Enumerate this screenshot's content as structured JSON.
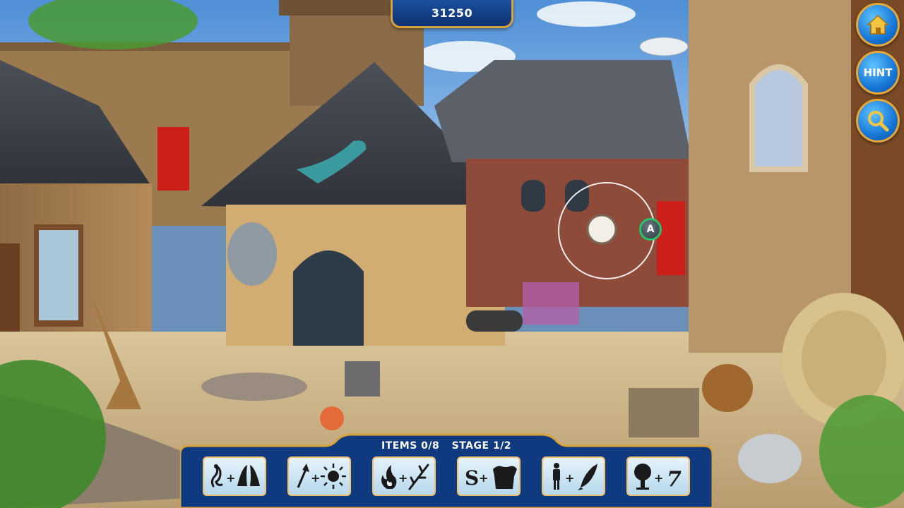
{
  "hud": {
    "score": "31250",
    "hint_label": "HINT",
    "items_progress": "ITEMS 0/8",
    "stage_progress": "STAGE 1/2"
  },
  "buttons": [
    {
      "name": "home",
      "icon": "house-icon"
    },
    {
      "name": "hint",
      "icon": "hint-text"
    },
    {
      "name": "zoom",
      "icon": "magnifier-icon"
    }
  ],
  "item_slots": [
    {
      "clue": "lizard + wings",
      "icons": [
        "lizard-icon",
        "plus-icon",
        "wings-icon"
      ]
    },
    {
      "clue": "arrow + sun",
      "icons": [
        "arrow-up-icon",
        "plus-icon",
        "sun-icon"
      ]
    },
    {
      "clue": "fire + branch",
      "icons": [
        "fire-icon",
        "plus-icon",
        "branch-icon"
      ]
    },
    {
      "clue": "S + armor",
      "icons": [
        "letter-s-icon",
        "plus-icon",
        "chainmail-icon"
      ]
    },
    {
      "clue": "person + fish",
      "icons": [
        "person-icon",
        "plus-icon",
        "fish-icon"
      ]
    },
    {
      "clue": "tree + 7",
      "icons": [
        "tree-icon",
        "plus-icon",
        "seven-icon"
      ]
    }
  ],
  "cursor": {
    "badge": "A"
  },
  "colors": {
    "panel_blue": "#0e3273",
    "panel_border": "#d9a13a",
    "button_blue": "#1677d6",
    "slot_bg": "#cfe6f4",
    "cursor_ring": "#ffffff",
    "cursor_badge_border": "#27c46a"
  }
}
